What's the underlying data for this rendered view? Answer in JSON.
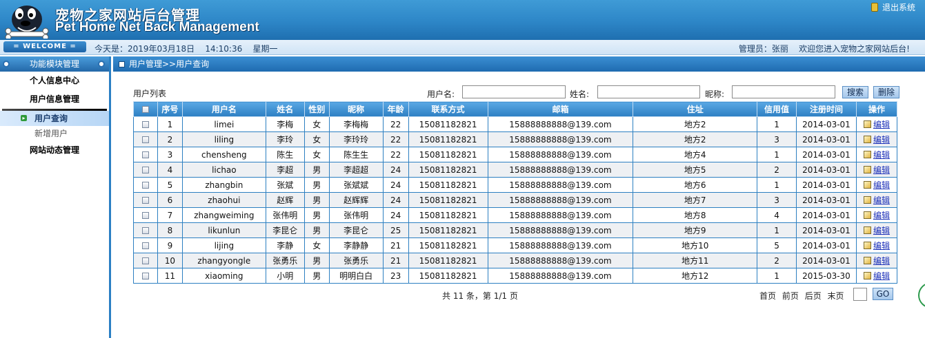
{
  "header": {
    "title_cn": "宠物之家网站后台管理",
    "title_en": "Pet Home Net Back Management",
    "logout": "退出系统"
  },
  "infobar": {
    "welcome": "WELCOME",
    "today": "今天是：2019年03月18日    14:10:36    星期一",
    "admin": "管理员：张丽    欢迎您进入宠物之家网站后台!"
  },
  "sidebar": {
    "title": "功能模块管理",
    "items": [
      "个人信息中心",
      "用户信息管理"
    ],
    "active": "用户查询",
    "sub": "新增用户",
    "last": "网站动态管理"
  },
  "breadcrumb": "用户管理>>用户查询",
  "search": {
    "list_label": "用户列表",
    "username_label": "用户名:",
    "name_label": "姓名:",
    "nickname_label": "昵称:",
    "username_value": "",
    "name_value": "",
    "nickname_value": "",
    "search_button": "搜索",
    "delete_button": "删除"
  },
  "table": {
    "headers": [
      "",
      "序号",
      "用户名",
      "姓名",
      "性别",
      "昵称",
      "年龄",
      "联系方式",
      "邮箱",
      "住址",
      "信用值",
      "注册时间",
      "操作"
    ],
    "edit_label": "编辑",
    "rows": [
      [
        "1",
        "limei",
        "李梅",
        "女",
        "李梅梅",
        "22",
        "15081182821",
        "15888888888@139.com",
        "地方2",
        "1",
        "2014-03-01"
      ],
      [
        "2",
        "liling",
        "李玲",
        "女",
        "李玲玲",
        "22",
        "15081182821",
        "15888888888@139.com",
        "地方2",
        "3",
        "2014-03-01"
      ],
      [
        "3",
        "chensheng",
        "陈生",
        "女",
        "陈生生",
        "22",
        "15081182821",
        "15888888888@139.com",
        "地方4",
        "1",
        "2014-03-01"
      ],
      [
        "4",
        "lichao",
        "李超",
        "男",
        "李超超",
        "24",
        "15081182821",
        "15888888888@139.com",
        "地方5",
        "2",
        "2014-03-01"
      ],
      [
        "5",
        "zhangbin",
        "张斌",
        "男",
        "张斌斌",
        "24",
        "15081182821",
        "15888888888@139.com",
        "地方6",
        "1",
        "2014-03-01"
      ],
      [
        "6",
        "zhaohui",
        "赵辉",
        "男",
        "赵辉辉",
        "24",
        "15081182821",
        "15888888888@139.com",
        "地方7",
        "3",
        "2014-03-01"
      ],
      [
        "7",
        "zhangweiming",
        "张伟明",
        "男",
        "张伟明",
        "24",
        "15081182821",
        "15888888888@139.com",
        "地方8",
        "4",
        "2014-03-01"
      ],
      [
        "8",
        "likunlun",
        "李昆仑",
        "男",
        "李昆仑",
        "25",
        "15081182821",
        "15888888888@139.com",
        "地方9",
        "1",
        "2014-03-01"
      ],
      [
        "9",
        "lijing",
        "李静",
        "女",
        "李静静",
        "21",
        "15081182821",
        "15888888888@139.com",
        "地方10",
        "5",
        "2014-03-01"
      ],
      [
        "10",
        "zhangyongle",
        "张勇乐",
        "男",
        "张勇乐",
        "21",
        "15081182821",
        "15888888888@139.com",
        "地方11",
        "2",
        "2014-03-01"
      ],
      [
        "11",
        "xiaoming",
        "小明",
        "男",
        "明明白白",
        "23",
        "15081182821",
        "15888888888@139.com",
        "地方12",
        "1",
        "2015-03-30"
      ]
    ]
  },
  "pager": {
    "total": "共 11 条，第 1/1 页",
    "first": "首页",
    "prev": "前页",
    "next": "后页",
    "last": "末页",
    "go": "GO",
    "page_value": ""
  },
  "colors": {
    "header_blue": "#2d86c7",
    "link_blue": "#1b2fb8",
    "row_alt": "#eef0f3"
  },
  "icons": {
    "logo": "dog-mascot-icon",
    "logout": "lock-icon",
    "edit": "edit-icon",
    "active_arrow": "arrow-right-icon"
  }
}
